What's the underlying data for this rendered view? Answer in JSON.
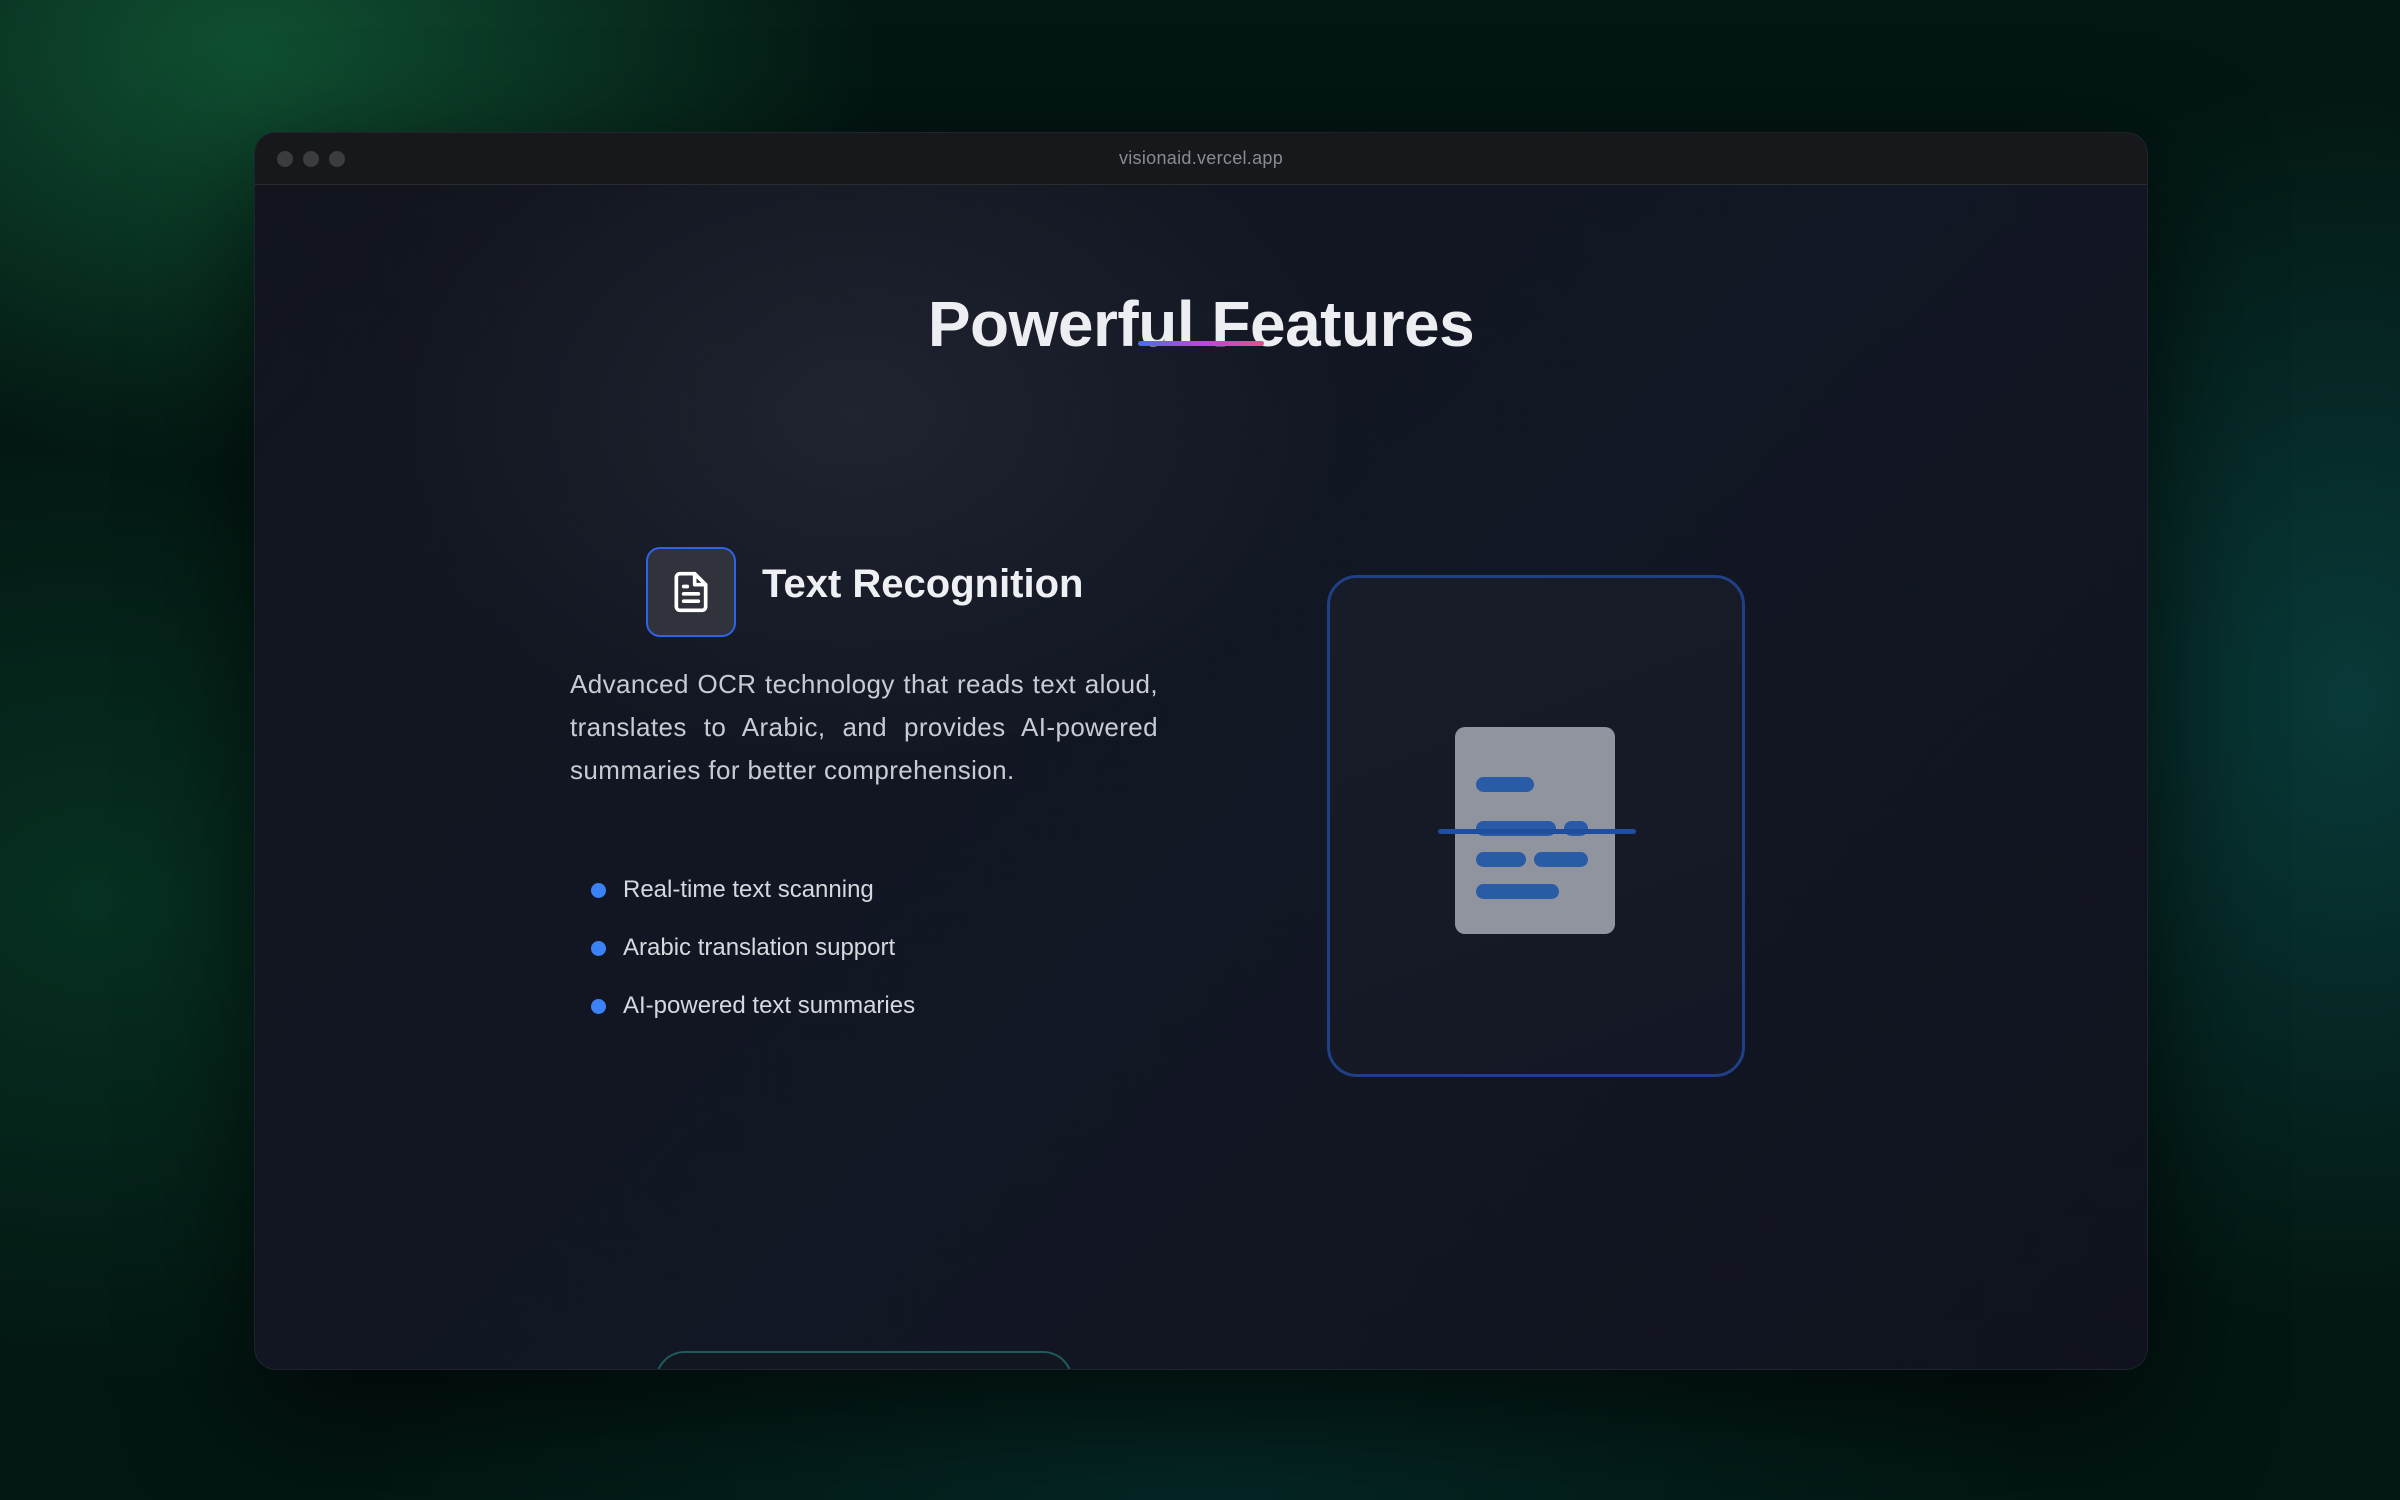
{
  "browser": {
    "url": "visionaid.vercel.app"
  },
  "section": {
    "title": "Powerful Features"
  },
  "feature": {
    "icon": "file-text-icon",
    "title": "Text Recognition",
    "description": "Advanced OCR technology that reads text aloud, translates to Arabic, and provides AI-powered summaries for better comprehension.",
    "bullets": [
      "Real-time text scanning",
      "Arabic translation support",
      "AI-powered text summaries"
    ]
  },
  "colors": {
    "accent_blue": "#3b82f6",
    "icon_border": "#2f62e6",
    "card_border": "#1f3f86",
    "underline_start": "#4a6cf0",
    "underline_end": "#ec4b8c"
  }
}
